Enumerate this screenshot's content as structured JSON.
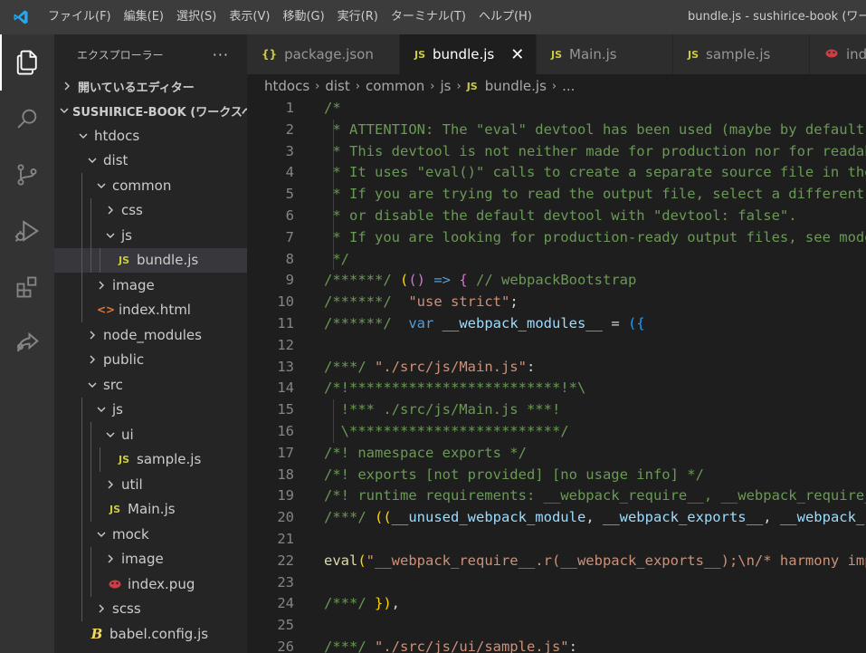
{
  "menu": [
    "ファイル(F)",
    "編集(E)",
    "選択(S)",
    "表示(V)",
    "移動(G)",
    "実行(R)",
    "ターミナル(T)",
    "ヘルプ(H)"
  ],
  "window_title": "bundle.js - sushirice-book (ワークスペース)",
  "sidebar": {
    "title": "エクスプローラー",
    "more": "···",
    "open_editors": "開いているエディター",
    "workspace": "SUSHIRICE-BOOK (ワークスペース)",
    "tree": [
      {
        "label": "htdocs",
        "type": "folder",
        "open": true,
        "depth": 0
      },
      {
        "label": "dist",
        "type": "folder",
        "open": true,
        "depth": 1
      },
      {
        "label": "common",
        "type": "folder",
        "open": true,
        "depth": 2
      },
      {
        "label": "css",
        "type": "folder",
        "open": false,
        "depth": 3
      },
      {
        "label": "js",
        "type": "folder",
        "open": true,
        "depth": 3
      },
      {
        "label": "bundle.js",
        "type": "js",
        "depth": 4,
        "selected": true
      },
      {
        "label": "image",
        "type": "folder",
        "open": false,
        "depth": 2
      },
      {
        "label": "index.html",
        "type": "html",
        "depth": 2
      },
      {
        "label": "node_modules",
        "type": "folder",
        "open": false,
        "depth": 1
      },
      {
        "label": "public",
        "type": "folder",
        "open": false,
        "depth": 1
      },
      {
        "label": "src",
        "type": "folder",
        "open": true,
        "depth": 1
      },
      {
        "label": "js",
        "type": "folder",
        "open": true,
        "depth": 2
      },
      {
        "label": "ui",
        "type": "folder",
        "open": true,
        "depth": 3
      },
      {
        "label": "sample.js",
        "type": "js",
        "depth": 4
      },
      {
        "label": "util",
        "type": "folder",
        "open": false,
        "depth": 3
      },
      {
        "label": "Main.js",
        "type": "js",
        "depth": 3
      },
      {
        "label": "mock",
        "type": "folder",
        "open": true,
        "depth": 2
      },
      {
        "label": "image",
        "type": "folder",
        "open": false,
        "depth": 3
      },
      {
        "label": "index.pug",
        "type": "pug",
        "depth": 3
      },
      {
        "label": "scss",
        "type": "folder",
        "open": false,
        "depth": 2
      },
      {
        "label": "babel.config.js",
        "type": "babel",
        "depth": 1
      }
    ]
  },
  "icons": {
    "js": "JS",
    "json": "{}",
    "html": "<>",
    "babel": "B"
  },
  "tabs": [
    {
      "label": "package.json",
      "icon": "json",
      "active": false
    },
    {
      "label": "bundle.js",
      "icon": "js",
      "active": true,
      "close": "✕"
    },
    {
      "label": "Main.js",
      "icon": "js",
      "active": false
    },
    {
      "label": "sample.js",
      "icon": "js",
      "active": false
    },
    {
      "label": "index.pug",
      "icon": "pug",
      "active": false
    }
  ],
  "breadcrumb": [
    "htdocs",
    "dist",
    "common",
    "js",
    "bundle.js",
    "..."
  ],
  "breadcrumb_sep": "›",
  "code_lines": [
    {
      "n": "1",
      "t": [
        [
          "c-com",
          "/*"
        ]
      ]
    },
    {
      "n": "2",
      "g": true,
      "t": [
        [
          "c-com",
          " * ATTENTION: The \"eval\" devtool has been used (maybe by default in mode: \"development\")."
        ]
      ]
    },
    {
      "n": "3",
      "g": true,
      "t": [
        [
          "c-com",
          " * This devtool is not neither made for production nor for readable output files."
        ]
      ]
    },
    {
      "n": "4",
      "g": true,
      "t": [
        [
          "c-com",
          " * It uses \"eval()\" calls to create a separate source file in the browser devtools."
        ]
      ]
    },
    {
      "n": "5",
      "g": true,
      "t": [
        [
          "c-com",
          " * If you are trying to read the output file, select a different devtool (https://webpack.js.org/configuration/devtool/)"
        ]
      ]
    },
    {
      "n": "6",
      "g": true,
      "t": [
        [
          "c-com",
          " * or disable the default devtool with \"devtool: false\"."
        ]
      ]
    },
    {
      "n": "7",
      "g": true,
      "t": [
        [
          "c-com",
          " * If you are looking for production-ready output files, see mode: \"production\" (https://webpack.js.org/configuration/mode/)."
        ]
      ]
    },
    {
      "n": "8",
      "g": true,
      "t": [
        [
          "c-com",
          " */"
        ]
      ]
    },
    {
      "n": "9",
      "t": [
        [
          "c-com",
          "/******/ "
        ],
        [
          "c-p1",
          "("
        ],
        [
          "c-p2",
          "()"
        ],
        [
          "c-kw",
          " => "
        ],
        [
          "c-p2",
          "{"
        ],
        [
          "c-com",
          " // webpackBootstrap"
        ]
      ]
    },
    {
      "n": "10",
      "t": [
        [
          "c-com",
          "/******/ "
        ],
        [
          "c-str",
          " \"use strict\""
        ],
        [
          "c-txt",
          ";"
        ]
      ]
    },
    {
      "n": "11",
      "t": [
        [
          "c-com",
          "/******/ "
        ],
        [
          "c-kw",
          " var "
        ],
        [
          "c-var",
          "__webpack_modules__"
        ],
        [
          "c-txt",
          " = "
        ],
        [
          "c-p3",
          "({"
        ]
      ]
    },
    {
      "n": "12",
      "t": []
    },
    {
      "n": "13",
      "t": [
        [
          "c-com",
          "/***/ "
        ],
        [
          "c-str",
          "\"./src/js/Main.js\""
        ],
        [
          "c-txt",
          ":"
        ]
      ]
    },
    {
      "n": "14",
      "t": [
        [
          "c-com",
          "/*!*************************!*\\"
        ]
      ]
    },
    {
      "n": "15",
      "g": true,
      "t": [
        [
          "c-com",
          "  !*** ./src/js/Main.js ***!"
        ]
      ]
    },
    {
      "n": "16",
      "g": true,
      "t": [
        [
          "c-com",
          "  \\*************************/"
        ]
      ]
    },
    {
      "n": "17",
      "t": [
        [
          "c-com",
          "/*! namespace exports */"
        ]
      ]
    },
    {
      "n": "18",
      "t": [
        [
          "c-com",
          "/*! exports [not provided] [no usage info] */"
        ]
      ]
    },
    {
      "n": "19",
      "t": [
        [
          "c-com",
          "/*! runtime requirements: __webpack_require__, __webpack_require__.r, __webpack_exports__ */"
        ]
      ]
    },
    {
      "n": "20",
      "t": [
        [
          "c-com",
          "/***/ "
        ],
        [
          "c-p1",
          "(("
        ],
        [
          "c-var",
          "__unused_webpack_module"
        ],
        [
          "c-txt",
          ", "
        ],
        [
          "c-var",
          "__webpack_exports__"
        ],
        [
          "c-txt",
          ", "
        ],
        [
          "c-var",
          "__webpack_require__"
        ],
        [
          "c-p1",
          ")"
        ],
        [
          "c-kw",
          " => "
        ],
        [
          "c-p2",
          "{"
        ]
      ]
    },
    {
      "n": "21",
      "t": []
    },
    {
      "n": "22",
      "t": [
        [
          "c-fn",
          "eval"
        ],
        [
          "c-p1",
          "("
        ],
        [
          "c-str",
          "\"__webpack_require__.r(__webpack_exports__);\\n/* harmony import */ var _ui_sample_js__WEBPACK_IMPORTED_MODULE_0__\""
        ]
      ]
    },
    {
      "n": "23",
      "t": []
    },
    {
      "n": "24",
      "t": [
        [
          "c-com",
          "/***/ "
        ],
        [
          "c-p1",
          "})"
        ],
        [
          "c-txt",
          ","
        ]
      ]
    },
    {
      "n": "25",
      "t": []
    },
    {
      "n": "26",
      "t": [
        [
          "c-com",
          "/***/ "
        ],
        [
          "c-str",
          "\"./src/js/ui/sample.js\""
        ],
        [
          "c-txt",
          ":"
        ]
      ]
    }
  ]
}
